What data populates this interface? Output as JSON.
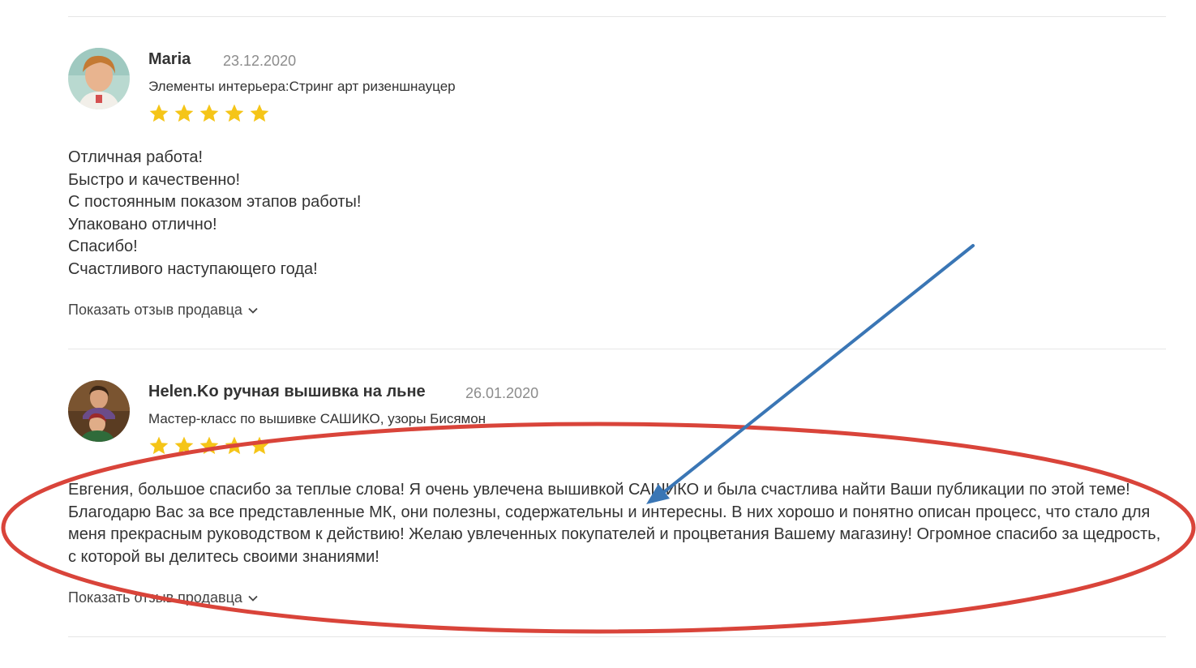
{
  "reviews": [
    {
      "author": "Maria",
      "date": "23.12.2020",
      "product": "Элементы интерьера:Стринг арт ризеншнауцер",
      "rating": 5,
      "text_lines": [
        "Отличная работа!",
        "Быстро и качественно!",
        "С постоянным показом этапов работы!",
        "Упаковано отлично!",
        "Спасибо!",
        "Счастливого наступающего года!"
      ],
      "show_seller_label": "Показать отзыв продавца"
    },
    {
      "author": "Helen.Ko ручная вышивка на льне",
      "date": "26.01.2020",
      "product": "Мастер-класс по вышивке САШИКО, узоры Бисямон",
      "rating": 5,
      "text": "Евгения, большое спасибо за теплые слова! Я очень увлечена вышивкой САШИКО и была счастлива найти Ваши публикации по этой теме! Благодарю Вас за все представленные МК, они полезны, содержательны и интересны. В них хорошо и понятно описан процесс, что стало для меня прекрасным руководством к действию! Желаю увлеченных покупателей и процветания Вашему магазину! Огромное спасибо за щедрость, с которой вы делитесь своими знаниями!",
      "show_seller_label": "Показать отзыв продавца"
    }
  ],
  "colors": {
    "star": "#f5c518",
    "annotation_ellipse": "#d9443a",
    "annotation_arrow": "#3a76b5"
  },
  "icons": {
    "star": "star-icon",
    "chevron": "chevron-down-icon"
  }
}
